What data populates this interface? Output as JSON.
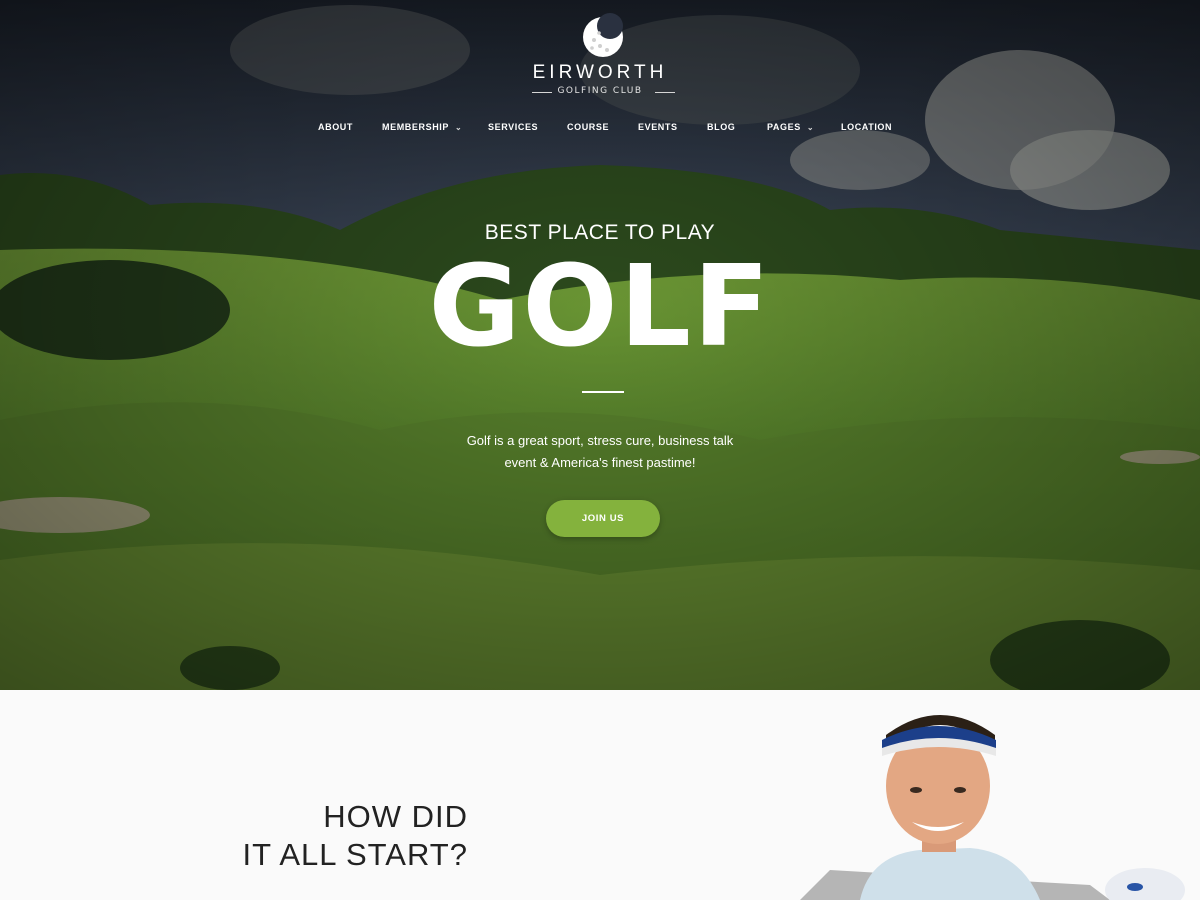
{
  "brand": {
    "name": "EIRWORTH",
    "tagline": "GOLFING CLUB"
  },
  "nav": {
    "items": [
      {
        "label": "ABOUT",
        "has_dropdown": false
      },
      {
        "label": "MEMBERSHIP",
        "has_dropdown": true
      },
      {
        "label": "SERVICES",
        "has_dropdown": false
      },
      {
        "label": "COURSE",
        "has_dropdown": false
      },
      {
        "label": "EVENTS",
        "has_dropdown": false
      },
      {
        "label": "BLOG",
        "has_dropdown": false
      },
      {
        "label": "PAGES",
        "has_dropdown": true
      },
      {
        "label": "LOCATION",
        "has_dropdown": false
      }
    ]
  },
  "hero": {
    "tagline": "BEST PLACE TO PLAY",
    "title": "GOLF",
    "description_line1": "Golf is a great sport, stress cure, business talk",
    "description_line2": "event & America's finest pastime!",
    "cta_label": "JOIN US"
  },
  "about": {
    "heading_line1": "HOW DID",
    "heading_line2": "IT ALL START?"
  },
  "colors": {
    "accent": "#84b23d",
    "sky_dark": "#1f2530",
    "grass": "#5f8a2c",
    "heading_text": "#222222"
  },
  "icons": {
    "logo": "golf-ball-icon",
    "dropdown": "chevron-down-icon"
  }
}
